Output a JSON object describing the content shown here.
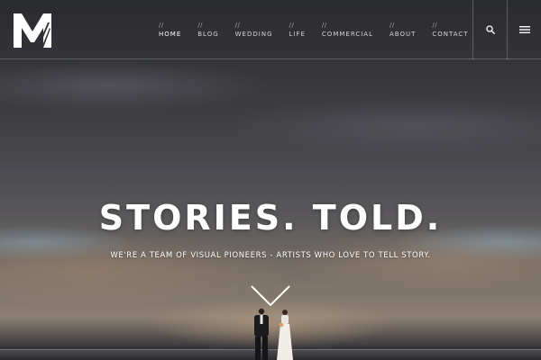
{
  "header": {
    "logo_text": "M",
    "nav": [
      {
        "slash": "//",
        "label": "HOME",
        "active": true
      },
      {
        "slash": "//",
        "label": "BLOG",
        "active": false
      },
      {
        "slash": "//",
        "label": "WEDDING",
        "active": false
      },
      {
        "slash": "//",
        "label": "LIFE",
        "active": false
      },
      {
        "slash": "//",
        "label": "COMMERCIAL",
        "active": false
      },
      {
        "slash": "//",
        "label": "ABOUT",
        "active": false
      },
      {
        "slash": "//",
        "label": "CONTACT",
        "active": false
      }
    ],
    "icons": {
      "search": "search-icon",
      "menu": "hamburger-menu-icon"
    }
  },
  "hero": {
    "headline": "STORIES. TOLD.",
    "tagline": "WE'RE A TEAM OF VISUAL PIONEERS - ARTISTS WHO LOVE TO TELL STORY.",
    "scroll_icon": "chevron-down-icon"
  },
  "colors": {
    "text": "#ffffff",
    "divider": "rgba(255,255,255,0.22)"
  }
}
